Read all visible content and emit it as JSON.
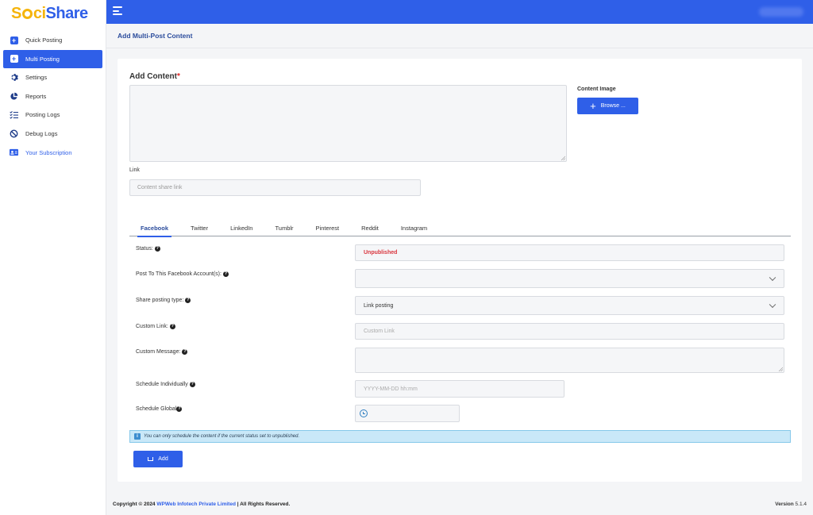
{
  "app": {
    "logo_part1": "S",
    "logo_part2": "ci",
    "logo_part3": "Share"
  },
  "sidebar": {
    "items": [
      {
        "label": "Quick Posting",
        "icon": "plus-square-icon"
      },
      {
        "label": "Multi Posting",
        "icon": "plus-square-icon"
      },
      {
        "label": "Settings",
        "icon": "gear-icon"
      },
      {
        "label": "Reports",
        "icon": "pie-chart-icon"
      },
      {
        "label": "Posting Logs",
        "icon": "list-check-icon"
      },
      {
        "label": "Debug Logs",
        "icon": "ban-icon"
      },
      {
        "label": "Your Subscription",
        "icon": "id-card-icon"
      }
    ],
    "active_index": 1
  },
  "header": {
    "page_title": "Add Multi-Post Content"
  },
  "form": {
    "add_content_label": "Add Content",
    "required_mark": "*",
    "content_image_label": "Content Image",
    "browse_label": "Browse ...",
    "link_label": "Link",
    "link_placeholder": "Content share link"
  },
  "tabs": [
    "Facebook",
    "Twitter",
    "LinkedIn",
    "Tumblr",
    "Pinterest",
    "Reddit",
    "Instagram"
  ],
  "active_tab": "Facebook",
  "facebook": {
    "status_label": "Status:",
    "status_value": "Unpublished",
    "accounts_label": "Post To This Facebook Account(s):",
    "accounts_value": "",
    "share_type_label": "Share posting type:",
    "share_type_value": "Link posting",
    "custom_link_label": "Custom Link:",
    "custom_link_placeholder": "Custom Link",
    "custom_message_label": "Custom Message:",
    "schedule_individual_label": "Schedule Individually",
    "schedule_individual_placeholder": "YYYY-MM-DD hh:mm",
    "schedule_global_label": "Schedule Global"
  },
  "info_text": "You can only schedule the content if the current status set to unpublished.",
  "add_button_label": "Add",
  "footer": {
    "copyright_prefix": "Copyright © 2024 ",
    "company": "WPWeb Infotech Private Limited",
    "copyright_suffix": " | All Rights Reserved.",
    "version_label": "Version",
    "version_value": "5.1.4"
  },
  "colors": {
    "primary": "#2f5fe8",
    "logo_yellow": "#f5b40b",
    "status_red": "#d9363e",
    "info_bg": "#c9e8f8"
  }
}
